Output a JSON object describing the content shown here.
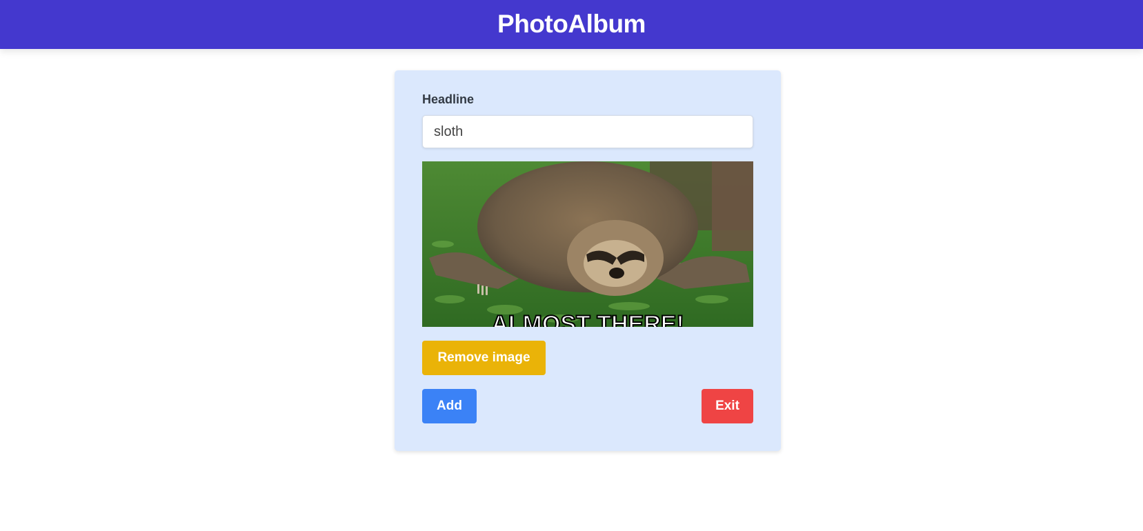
{
  "header": {
    "title": "PhotoAlbum"
  },
  "form": {
    "headline_label": "Headline",
    "headline_value": "sloth",
    "image": {
      "alt": "sloth",
      "caption_overlay": "ALMOST THERE!"
    },
    "remove_image_label": "Remove image",
    "add_label": "Add",
    "exit_label": "Exit"
  },
  "colors": {
    "header_bg": "#4438ce",
    "card_bg": "#dbe8fd",
    "remove_button": "#eab308",
    "add_button": "#3b82f6",
    "exit_button": "#ef4444"
  }
}
